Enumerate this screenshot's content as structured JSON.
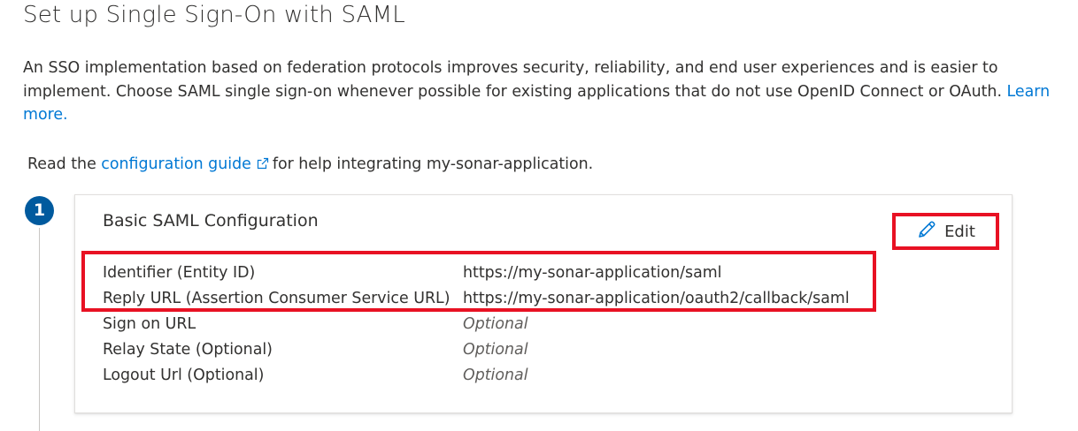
{
  "header": {
    "title": "Set up Single Sign-On with SAML"
  },
  "intro": {
    "text": "An SSO implementation based on federation protocols improves security, reliability, and end user experiences and is easier to implement. Choose SAML single sign-on whenever possible for existing applications that do not use OpenID Connect or OAuth. ",
    "learn_more": "Learn more."
  },
  "guide": {
    "prefix": "Read the ",
    "link_text": "configuration guide",
    "suffix": "for help integrating my-sonar-application."
  },
  "step": {
    "number": "1",
    "card_title": "Basic SAML Configuration",
    "edit_label": "Edit",
    "edit_icon": "pencil-icon",
    "rows": [
      {
        "label": "Identifier (Entity ID)",
        "value": "https://my-sonar-application/saml",
        "optional": false
      },
      {
        "label": "Reply URL (Assertion Consumer Service URL)",
        "value": "https://my-sonar-application/oauth2/callback/saml",
        "optional": false
      },
      {
        "label": "Sign on URL",
        "value": "Optional",
        "optional": true
      },
      {
        "label": "Relay State (Optional)",
        "value": "Optional",
        "optional": true
      },
      {
        "label": "Logout Url (Optional)",
        "value": "Optional",
        "optional": true
      }
    ]
  },
  "colors": {
    "accent": "#0078d4",
    "badge": "#005a9e",
    "highlight": "#e81123",
    "text": "#323130"
  }
}
